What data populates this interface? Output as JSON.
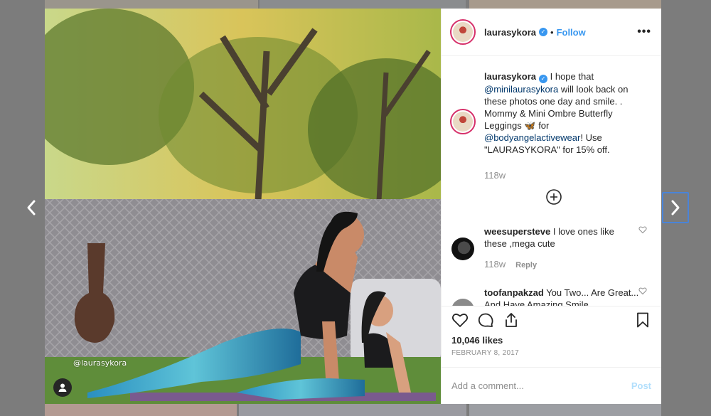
{
  "post": {
    "username": "laurasykora",
    "follow_label": "Follow",
    "more_label": "•••",
    "watermark": "@laurasykora"
  },
  "caption": {
    "username": "laurasykora",
    "part1": "I hope that ",
    "mention1": "@minilaurasykora",
    "part2": " will look back on these photos one day and smile. . Mommy & Mini Ombre Butterfly Leggings ",
    "emoji": "🦋",
    "part3": " for ",
    "mention2": "@bodyangelactivewear",
    "part4": "! Use \"LAURASYKORA\" for 15% off.",
    "time": "118w"
  },
  "comments": [
    {
      "username": "weesupersteve",
      "text": "I love ones like these ,mega cute",
      "time": "118w",
      "reply_label": "Reply"
    },
    {
      "username": "toofanpakzad",
      "text": "You Two... Are Great... And Have Amazing Smile",
      "time": "",
      "reply_label": ""
    }
  ],
  "stats": {
    "likes": "10,046 likes",
    "date": "FEBRUARY 8, 2017"
  },
  "compose": {
    "placeholder": "Add a comment...",
    "post_label": "Post"
  },
  "colors": {
    "accent": "#3897f0",
    "post_disabled": "#b2dffc",
    "story_ring": "#d6306a",
    "nav_focus": "#4a84d8"
  },
  "icons": [
    "chevron-left-icon",
    "chevron-right-icon",
    "user-tag-icon",
    "more-icon",
    "verified-icon",
    "add-circle-icon",
    "heart-icon",
    "comment-icon",
    "share-icon",
    "bookmark-icon"
  ]
}
